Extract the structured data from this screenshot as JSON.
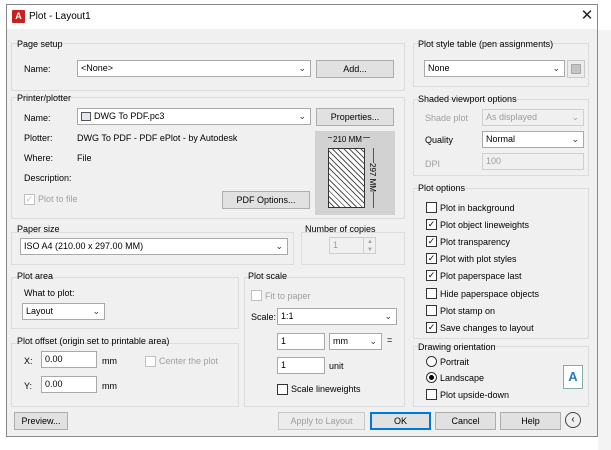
{
  "dialog": {
    "title": "Plot - Layout1",
    "logo_letter": "A"
  },
  "page_setup": {
    "group_label": "Page setup",
    "name_label": "Name:",
    "name_value": "<None>",
    "add_button": "Add..."
  },
  "printer": {
    "group_label": "Printer/plotter",
    "name_label": "Name:",
    "name_value": "DWG To PDF.pc3",
    "properties_button": "Properties...",
    "plotter_label": "Plotter:",
    "plotter_value": "DWG To PDF - PDF ePlot - by Autodesk",
    "where_label": "Where:",
    "where_value": "File",
    "description_label": "Description:",
    "plot_to_file_label": "Plot to file",
    "pdf_options_button": "PDF Options...",
    "preview_width": "210 MM",
    "preview_height": "297 MM"
  },
  "paper_size": {
    "group_label": "Paper size",
    "value": "ISO A4 (210.00 x 297.00 MM)"
  },
  "copies": {
    "group_label": "Number of copies",
    "value": "1"
  },
  "plot_area": {
    "group_label": "Plot area",
    "what_label": "What to plot:",
    "value": "Layout"
  },
  "plot_offset": {
    "group_label": "Plot offset (origin set to printable area)",
    "x_label": "X:",
    "x_value": "0.00",
    "x_unit": "mm",
    "y_label": "Y:",
    "y_value": "0.00",
    "y_unit": "mm",
    "center_label": "Center the plot"
  },
  "plot_scale": {
    "group_label": "Plot scale",
    "fit_label": "Fit to paper",
    "scale_label": "Scale:",
    "scale_value": "1:1",
    "value1": "1",
    "unit_value": "mm",
    "equals": "=",
    "value2": "1",
    "unit2_label": "unit",
    "lineweights_label": "Scale lineweights"
  },
  "plot_style_table": {
    "group_label": "Plot style table (pen assignments)",
    "value": "None"
  },
  "shaded_viewport": {
    "group_label": "Shaded viewport options",
    "shade_label": "Shade plot",
    "shade_value": "As displayed",
    "quality_label": "Quality",
    "quality_value": "Normal",
    "dpi_label": "DPI",
    "dpi_value": "100"
  },
  "plot_options": {
    "group_label": "Plot options",
    "items": [
      {
        "label": "Plot in background",
        "checked": false
      },
      {
        "label": "Plot object lineweights",
        "checked": true
      },
      {
        "label": "Plot transparency",
        "checked": true
      },
      {
        "label": "Plot with plot styles",
        "checked": true
      },
      {
        "label": "Plot paperspace last",
        "checked": true
      },
      {
        "label": "Hide paperspace objects",
        "checked": false
      },
      {
        "label": "Plot stamp on",
        "checked": false
      },
      {
        "label": "Save changes to layout",
        "checked": true
      }
    ]
  },
  "orientation": {
    "group_label": "Drawing orientation",
    "portrait_label": "Portrait",
    "landscape_label": "Landscape",
    "upside_down_label": "Plot upside-down",
    "icon_letter": "A"
  },
  "buttons": {
    "preview": "Preview...",
    "apply": "Apply to Layout",
    "ok": "OK",
    "cancel": "Cancel",
    "help": "Help"
  },
  "colors": {
    "accent": "#0078d7",
    "autocad_red": "#c8201f"
  }
}
